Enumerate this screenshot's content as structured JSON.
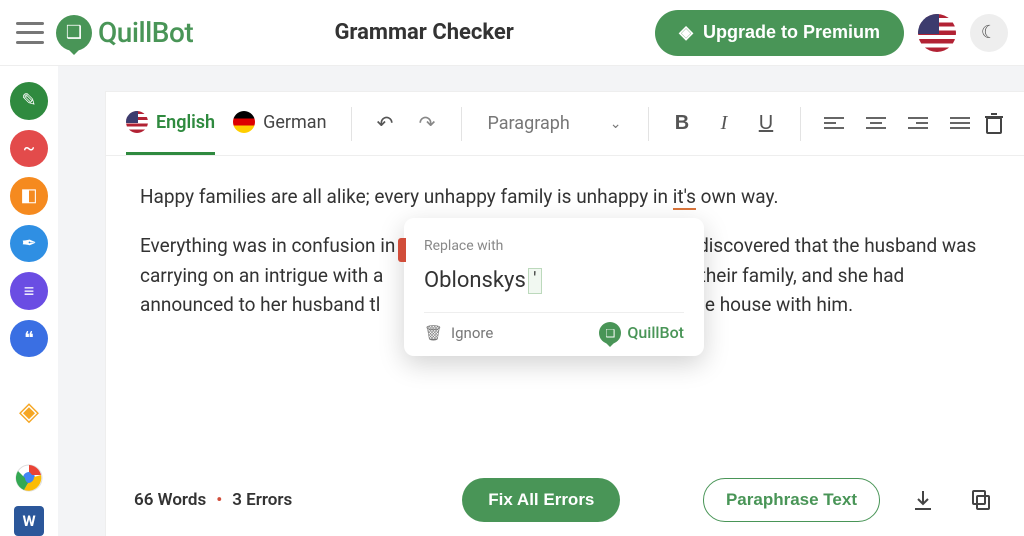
{
  "header": {
    "brand": "QuillBot",
    "page_title": "Grammar Checker",
    "upgrade_label": "Upgrade to Premium"
  },
  "rail": {
    "items": [
      {
        "name": "grammar-check-icon",
        "color": "#2f8a3f",
        "glyph": "✎"
      },
      {
        "name": "paraphraser-icon",
        "color": "#e34b4b",
        "glyph": "~"
      },
      {
        "name": "summarizer-icon",
        "color": "#f58a1f",
        "glyph": "◧"
      },
      {
        "name": "cowriter-icon",
        "color": "#2f8fe3",
        "glyph": "✒"
      },
      {
        "name": "plagiarism-icon",
        "color": "#6a4de3",
        "glyph": "≡"
      },
      {
        "name": "citations-icon",
        "color": "#3a6fe3",
        "glyph": "❝"
      }
    ],
    "extras": [
      {
        "name": "premium-diamond-icon",
        "glyph": "◈",
        "color": "#f5a623"
      },
      {
        "name": "chrome-extension-icon",
        "glyph": "◉",
        "color": "#e34b4b"
      },
      {
        "name": "word-addin-icon",
        "glyph": "W",
        "color": "#2b579a"
      }
    ]
  },
  "toolbar": {
    "languages": [
      {
        "label": "English",
        "flag": "us",
        "active": true
      },
      {
        "label": "German",
        "flag": "de",
        "active": false
      }
    ],
    "style_select": "Paragraph"
  },
  "document": {
    "p1_pre": "Happy families are all alike; every unhappy family is unhappy in ",
    "p1_err": "it's",
    "p1_post": " own way.",
    "p2_pre": "Everything was in confusion in the ",
    "p2_err": "Oblonskys",
    "p2_mid1": " house. The wife had discovered that the husband was carrying on an intrigue with a",
    "p2_mid2": "rness in their family, and she had announced to her husband tl",
    "p2_mid3": "he same house with him."
  },
  "suggestion": {
    "label": "Replace with",
    "base": "Oblonskys",
    "insert": "'",
    "ignore_label": "Ignore",
    "brand": "QuillBot"
  },
  "footer": {
    "word_count": "66 Words",
    "error_count": "3 Errors",
    "fix_label": "Fix All Errors",
    "paraphrase_label": "Paraphrase Text"
  }
}
